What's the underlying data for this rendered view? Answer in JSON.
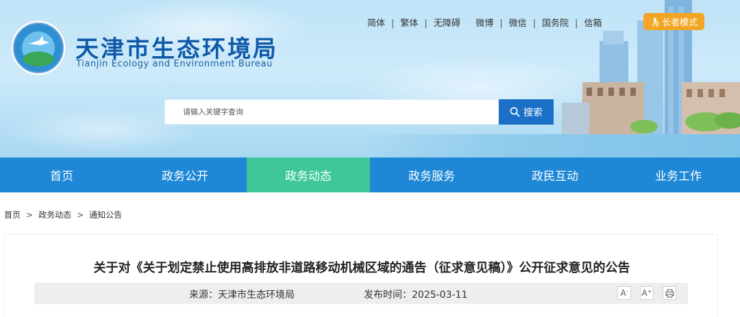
{
  "header": {
    "site_title": "天津市生态环境局",
    "site_subtitle": "Tianjin Ecology and Environment Bureau",
    "logo_icon": "bureau-emblem-icon",
    "top_links": [
      "简体",
      "繁体",
      "无障碍",
      "微博",
      "微信",
      "国务院",
      "信箱"
    ],
    "top_link_separator": "|",
    "elder_mode_label": "长者模式",
    "elder_mode_color": "#f2a623",
    "search": {
      "placeholder": "请输入关键字查询",
      "button_label": "搜索",
      "button_color": "#1b6fc6"
    }
  },
  "nav": {
    "items": [
      {
        "label": "首页"
      },
      {
        "label": "政务公开"
      },
      {
        "label": "政务动态"
      },
      {
        "label": "政务服务"
      },
      {
        "label": "政民互动"
      },
      {
        "label": "业务工作"
      }
    ],
    "active_label": "政务动态",
    "bar_color": "#1e88d6",
    "active_color": "#3fc79a"
  },
  "breadcrumb": {
    "items": [
      "首页",
      "政务动态",
      "通知公告"
    ],
    "separator": ">"
  },
  "article": {
    "title": "关于对《关于划定禁止使用高排放非道路移动机械区域的通告（征求意见稿）》公开征求意见的公告",
    "source": "来源：天津市生态环境局",
    "published": "发布时间：2025-03-11",
    "tools": {
      "decrease_font": "A",
      "increase_font": "A",
      "decrease_sign": "-",
      "increase_sign": "+",
      "print_icon": "printer-icon"
    }
  }
}
